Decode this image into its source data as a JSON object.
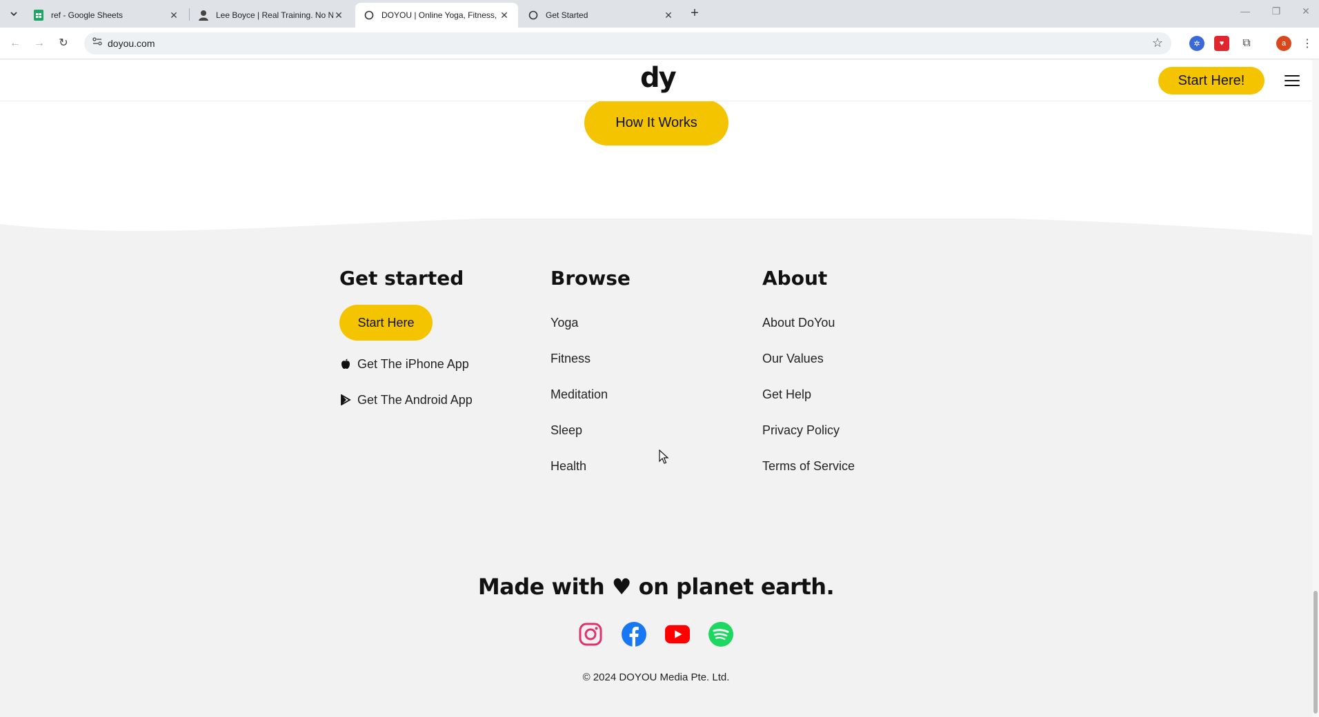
{
  "browser": {
    "tabs": [
      {
        "title": "ref - Google Sheets",
        "favicon": "sheets-icon"
      },
      {
        "title": "Lee Boyce | Real Training. No Nonsense.",
        "favicon": "person-icon"
      },
      {
        "title": "DOYOU | Online Yoga, Fitness, & More",
        "favicon": "globe-icon"
      },
      {
        "title": "Get Started",
        "favicon": "globe-icon"
      }
    ],
    "active_tab": 2,
    "url": "doyou.com",
    "profile_initial": "a"
  },
  "header": {
    "logo": "dy",
    "start_button": "Start Here!"
  },
  "hero": {
    "how_button": "How It Works"
  },
  "footer": {
    "get_started": {
      "heading": "Get started",
      "start_here": "Start Here",
      "iphone": "Get The iPhone App",
      "android": "Get The Android App"
    },
    "browse": {
      "heading": "Browse",
      "links": [
        "Yoga",
        "Fitness",
        "Meditation",
        "Sleep",
        "Health"
      ]
    },
    "about": {
      "heading": "About",
      "links": [
        "About DoYou",
        "Our Values",
        "Get Help",
        "Privacy Policy",
        "Terms of Service"
      ]
    },
    "tagline": "Made with ♥ on planet earth.",
    "social": [
      "instagram-icon",
      "facebook-icon",
      "youtube-icon",
      "spotify-icon"
    ],
    "copyright": "© 2024 DOYOU Media Pte. Ltd."
  },
  "colors": {
    "accent": "#f5c400",
    "footer_bg": "#f2f2f2"
  }
}
